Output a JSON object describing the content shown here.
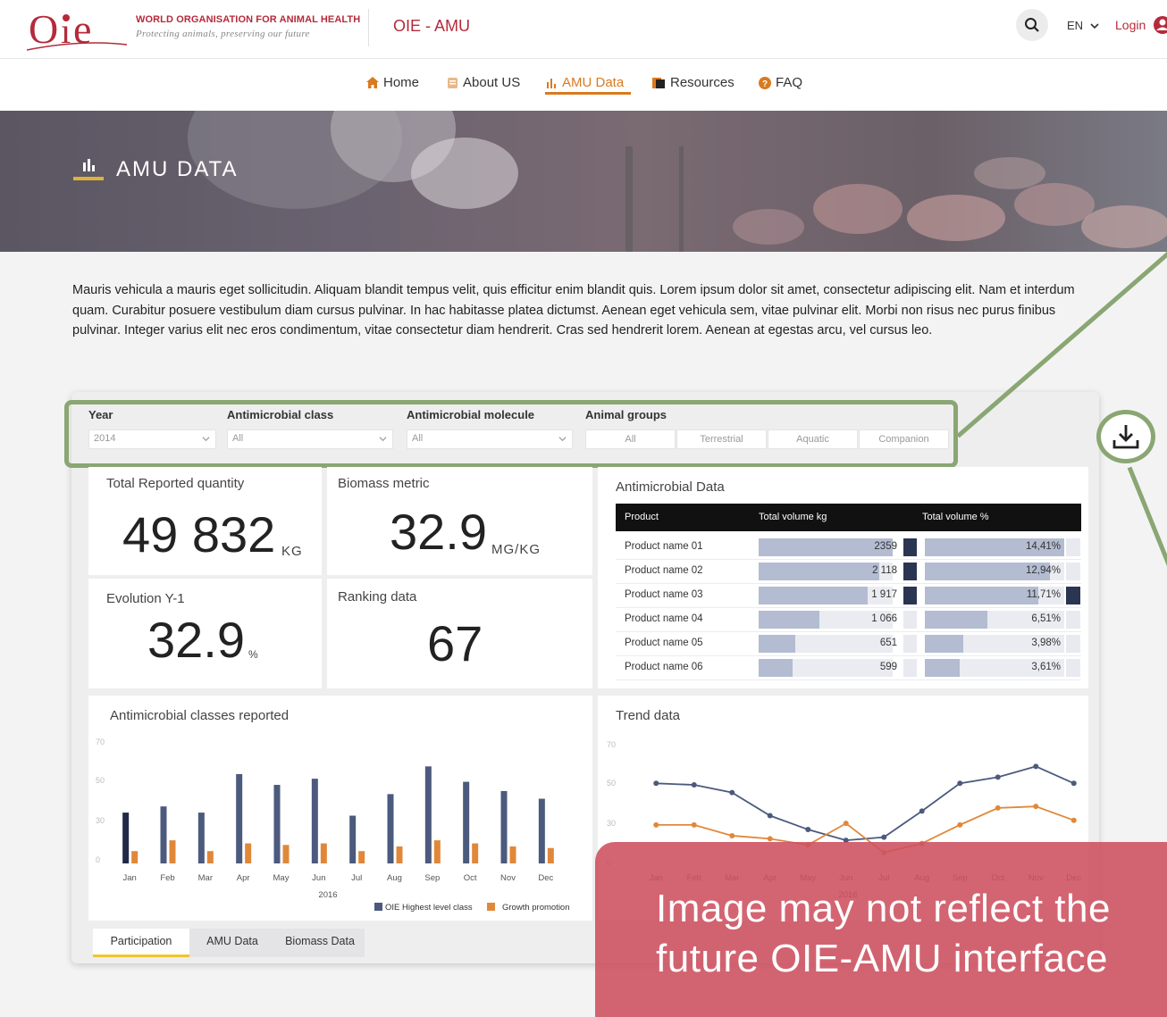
{
  "header": {
    "org_name": "WORLD ORGANISATION FOR ANIMAL HEALTH",
    "org_tagline": "Protecting animals, preserving our future",
    "app_title": "OIE - AMU",
    "language": "EN",
    "login": "Login"
  },
  "nav": {
    "items": [
      {
        "label": "Home",
        "icon": "home-icon"
      },
      {
        "label": "About US",
        "icon": "about-icon"
      },
      {
        "label": "AMU Data",
        "icon": "bar-chart-icon"
      },
      {
        "label": "Resources",
        "icon": "resources-icon"
      },
      {
        "label": "FAQ",
        "icon": "help-icon"
      }
    ],
    "active": "AMU Data"
  },
  "hero": {
    "title": "AMU DATA"
  },
  "intro": "Mauris vehicula a mauris eget sollicitudin. Aliquam blandit tempus velit, quis efficitur enim blandit quis. Lorem ipsum dolor sit amet, consectetur adipiscing elit. Nam et interdum quam. Curabitur posuere vestibulum diam cursus pulvinar. In hac habitasse platea dictumst. Aenean eget vehicula sem, vitae pulvinar elit. Morbi non risus nec purus finibus pulvinar. Integer varius elit nec eros condimentum, vitae consectetur diam hendrerit. Cras sed hendrerit lorem. Aenean at egestas arcu, vel cursus leo.",
  "filters": {
    "year": {
      "label": "Year",
      "value": "2014"
    },
    "class": {
      "label": "Antimicrobial class",
      "value": "All"
    },
    "molecule": {
      "label": "Antimicrobial molecule",
      "value": "All"
    },
    "groups": {
      "label": "Animal groups",
      "options": [
        "All",
        "Terrestrial",
        "Aquatic",
        "Companion"
      ]
    }
  },
  "kpis": {
    "total": {
      "title": "Total Reported quantity",
      "value": "49 832",
      "unit": "KG"
    },
    "biomass": {
      "title": "Biomass metric",
      "value": "32.9",
      "unit": "MG/KG"
    },
    "evolution": {
      "title": "Evolution Y-1",
      "value": "32.9",
      "unit": "%"
    },
    "ranking": {
      "title": "Ranking data",
      "value": "67"
    }
  },
  "table": {
    "title": "Antimicrobial Data",
    "headers": [
      "Product",
      "Total volume kg",
      "Total volume %"
    ],
    "rows": [
      {
        "name": "Product name  01",
        "kg": "2359",
        "kg_val": 2359,
        "pct": "14,41%",
        "pct_val": 14.41
      },
      {
        "name": "Product name  02",
        "kg": "2 118",
        "kg_val": 2118,
        "pct": "12,94%",
        "pct_val": 12.94
      },
      {
        "name": "Product name  03",
        "kg": "1 917",
        "kg_val": 1917,
        "pct": "11,71%",
        "pct_val": 11.71
      },
      {
        "name": "Product name  04",
        "kg": "1 066",
        "kg_val": 1066,
        "pct": "6,51%",
        "pct_val": 6.51
      },
      {
        "name": "Product name  05",
        "kg": "651",
        "kg_val": 651,
        "pct": "3,98%",
        "pct_val": 3.98
      },
      {
        "name": "Product name  06",
        "kg": "599",
        "kg_val": 599,
        "pct": "3,61%",
        "pct_val": 3.61
      }
    ]
  },
  "chart_data": [
    {
      "type": "bar",
      "title": "Antimicrobial classes reported",
      "xlabel": "2016",
      "categories": [
        "Jan",
        "Feb",
        "Mar",
        "Apr",
        "May",
        "Jun",
        "Jul",
        "Aug",
        "Sep",
        "Oct",
        "Nov",
        "Dec"
      ],
      "yticks": [
        "70",
        "50",
        "30",
        "0"
      ],
      "ylim": [
        0,
        80
      ],
      "series": [
        {
          "name": "OIE Highest level class",
          "color": "#4b5a7d",
          "values": [
            33,
            37,
            33,
            58,
            51,
            55,
            31,
            45,
            63,
            53,
            47,
            42
          ]
        },
        {
          "name": "Growth promotion",
          "color": "#e0883a",
          "values": [
            8,
            15,
            8,
            13,
            12,
            13,
            8,
            11,
            15,
            13,
            11,
            10
          ]
        }
      ],
      "legend": "bottom-right"
    },
    {
      "type": "line",
      "title": "Trend data",
      "xlabel": "2016",
      "categories": [
        "Jan",
        "Feb",
        "Mar",
        "Apr",
        "May",
        "Jun",
        "Jul",
        "Aug",
        "Sep",
        "Oct",
        "Nov",
        "Dec"
      ],
      "yticks": [
        "70",
        "50",
        "30",
        "0"
      ],
      "ylim": [
        0,
        80
      ],
      "series": [
        {
          "color": "#4b5a7d",
          "values": [
            52,
            51,
            46,
            31,
            22,
            15,
            17,
            34,
            52,
            56,
            63,
            52
          ]
        },
        {
          "color": "#e0883a",
          "values": [
            25,
            25,
            18,
            16,
            12,
            26,
            7,
            13,
            25,
            36,
            37,
            28
          ]
        }
      ]
    }
  ],
  "tabs": [
    "Participation",
    "AMU Data",
    "Biomass Data"
  ],
  "active_tab": "Participation",
  "disclaimer": [
    "Image may not reflect the",
    "future OIE-AMU interface"
  ]
}
